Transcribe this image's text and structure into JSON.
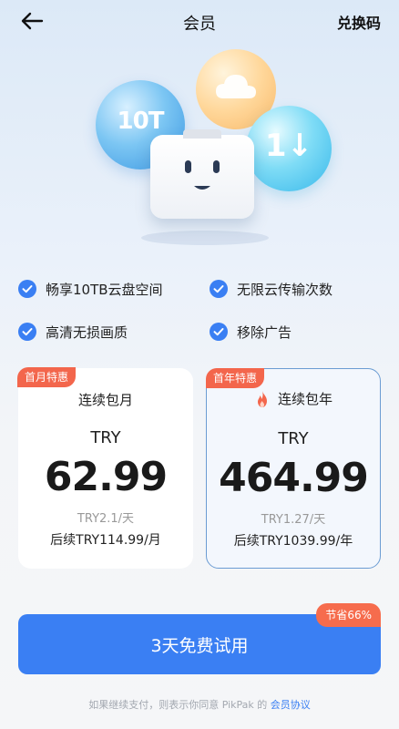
{
  "header": {
    "title": "会员",
    "redeem_label": "兑换码"
  },
  "hero": {
    "storage_badge": "10T",
    "transfer_badge": "1↓"
  },
  "features": [
    {
      "label": "畅享10TB云盘空间",
      "icon": "check-icon"
    },
    {
      "label": "无限云传输次数",
      "icon": "check-icon"
    },
    {
      "label": "高清无损画质",
      "icon": "check-icon"
    },
    {
      "label": "移除广告",
      "icon": "check-icon"
    }
  ],
  "plans": {
    "monthly": {
      "badge": "首月特惠",
      "name": "连续包月",
      "currency": "TRY",
      "price": "62.99",
      "daily": "TRY2.1/天",
      "renew": "后续TRY114.99/月"
    },
    "yearly": {
      "badge": "首年特惠",
      "name": "连续包年",
      "currency": "TRY",
      "price": "464.99",
      "daily": "TRY1.27/天",
      "renew": "后续TRY1039.99/年",
      "selected": true
    }
  },
  "cta": {
    "label": "3天免费试用",
    "save_badge": "节省66%"
  },
  "footer": {
    "note": "如果继续支付，则表示你同意 PikPak 的",
    "agreement_link": "会员协议"
  },
  "colors": {
    "accent": "#3a7ff3",
    "badge": "#f3664c",
    "selected_border": "#6b9cd3"
  }
}
